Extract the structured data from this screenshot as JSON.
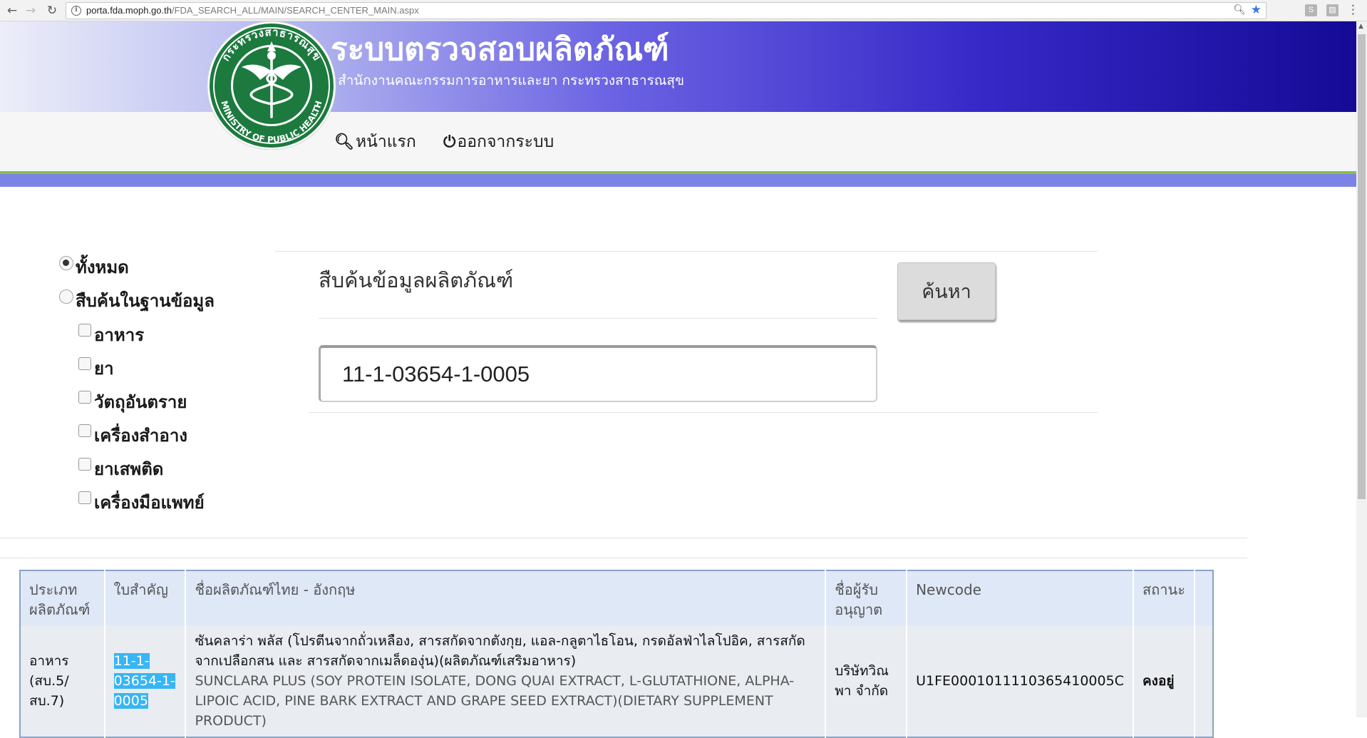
{
  "browser": {
    "url_host": "porta.fda.moph.go.th",
    "url_path": "/FDA_SEARCH_ALL/MAIN/SEARCH_CENTER_MAIN.aspx"
  },
  "header": {
    "title": "ระบบตรวจสอบผลิตภัณฑ์",
    "subtitle": "สำนักงานคณะกรรมการอาหารและยา กระทรวงสาธารณสุข",
    "logo_top_text": "กระทรวงสาธารณสุข",
    "logo_bottom_text": "MINISTRY OF PUBLIC HEALTH"
  },
  "nav": {
    "home_label": "หน้าแรก",
    "logout_label": "ออกจากระบบ"
  },
  "filters": {
    "all_label": "ทั้งหมด",
    "db_label": "สืบค้นในฐานข้อมูล",
    "categories": [
      "อาหาร",
      "ยา",
      "วัตถุอันตราย",
      "เครื่องสำอาง",
      "ยาเสพติด",
      "เครื่องมือแพทย์"
    ]
  },
  "search": {
    "heading": "สืบค้นข้อมูลผลิตภัณฑ์",
    "button_label": "ค้นหา",
    "value": "11-1-03654-1-0005"
  },
  "table": {
    "headers": [
      "ประเภทผลิตภัณฑ์",
      "ใบสำคัญ",
      "ชื่อผลิตภัณฑ์ไทย - อังกฤษ",
      "ชื่อผู้รับอนุญาต",
      "Newcode",
      "สถานะ",
      ""
    ],
    "rows": [
      {
        "type": "อาหาร (สบ.5/สบ.7)",
        "license": "11-1-03654-1-0005",
        "name_th": "ซันคลาร่า พลัส (โปรตีนจากถั่วเหลือง, สารสกัดจากตังกุย, แอล-กลูตาไธโอน, กรดอัลฟ่าไลโปอิค, สารสกัดจากเปลือกสน และ สารสกัดจากเมล็ดองุ่น)(ผลิตภัณฑ์เสริมอาหาร)",
        "name_en": "SUNCLARA PLUS (SOY PROTEIN ISOLATE, DONG QUAI EXTRACT, L-GLUTATHIONE, ALPHA-LIPOIC ACID, PINE BARK EXTRACT AND GRAPE SEED EXTRACT)(DIETARY SUPPLEMENT PRODUCT)",
        "licensee": "บริษัทวิณพา จำกัด",
        "newcode": "U1FE0001011110365410005C",
        "status": "คงอยู่"
      }
    ]
  },
  "colors": {
    "banner_start": "#eceef9",
    "banner_end": "#150a96",
    "accent_green": "#8bbf4b",
    "accent_blue": "#7b84e6",
    "table_header": "#dfe8f7",
    "selection": "#38b5f4",
    "logo_green": "#1c7a3e"
  }
}
